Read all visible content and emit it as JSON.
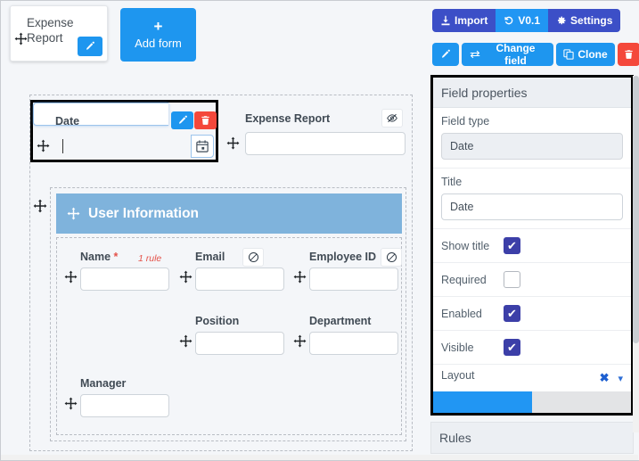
{
  "form_tabs": [
    {
      "label": "Expense Report",
      "edit_icon": "pencil-icon",
      "move_icon": "move-cross-icon"
    }
  ],
  "add_form_button": {
    "label": "Add form",
    "plus": "+",
    "icon": "plus-icon"
  },
  "toolbar_top": [
    {
      "label": "Import",
      "icon": "import-download-icon",
      "color": "#3c4fc7"
    },
    {
      "label": "V0.1",
      "icon": "history-undo-icon",
      "color": "#2196f3"
    },
    {
      "label": "Settings",
      "icon": "gear-icon",
      "color": "#3c4fc7"
    }
  ],
  "toolbar_second": [
    {
      "label": "",
      "icon": "pencil-icon",
      "color": "#1e96ef"
    },
    {
      "label": "Change field",
      "icon": "exchange-arrows-icon",
      "color": "#1e96ef"
    },
    {
      "label": "Clone",
      "icon": "copy-icon",
      "color": "#1e96ef"
    },
    {
      "label": "",
      "icon": "trash-icon",
      "color": "#f4483b"
    }
  ],
  "canvas": {
    "date_field": {
      "label": "Date",
      "value": "",
      "selected": true,
      "edit_icon": "pencil-icon",
      "delete_icon": "trash-icon",
      "calendar_icon": "calendar-icon",
      "move_icon": "move-cross-icon"
    },
    "expense_report_field": {
      "label": "Expense Report",
      "value": "",
      "state_icon": "eye-slash-icon",
      "move_icon": "move-cross-icon"
    },
    "section": {
      "title": "User Information",
      "move_icon": "move-cross-icon",
      "fields": [
        {
          "label": "Name",
          "required": true,
          "required_marker": "*",
          "rule_tag": "1 rule",
          "value": "",
          "state_icon": null,
          "move_icon": "move-cross-icon"
        },
        {
          "label": "Email",
          "required": false,
          "required_marker": "",
          "rule_tag": "",
          "value": "",
          "state_icon": "ban-icon",
          "move_icon": "move-cross-icon"
        },
        {
          "label": "Employee ID",
          "required": false,
          "required_marker": "",
          "rule_tag": "",
          "value": "",
          "state_icon": "ban-icon",
          "move_icon": "move-cross-icon"
        },
        {
          "label": "Position",
          "required": false,
          "required_marker": "",
          "rule_tag": "",
          "value": "",
          "state_icon": null,
          "move_icon": "move-cross-icon"
        },
        {
          "label": "Department",
          "required": false,
          "required_marker": "",
          "rule_tag": "",
          "value": "",
          "state_icon": null,
          "move_icon": "move-cross-icon"
        },
        {
          "label": "Manager",
          "required": false,
          "required_marker": "",
          "rule_tag": "",
          "value": "",
          "state_icon": null,
          "move_icon": "move-cross-icon"
        }
      ]
    }
  },
  "properties": {
    "header": "Field properties",
    "field_type": {
      "label": "Field type",
      "value": "Date"
    },
    "title": {
      "label": "Title",
      "value": "Date"
    },
    "show_title": {
      "label": "Show title",
      "checked": true,
      "check_glyph": "✔"
    },
    "required": {
      "label": "Required",
      "checked": false,
      "check_glyph": ""
    },
    "enabled": {
      "label": "Enabled",
      "checked": true,
      "check_glyph": "✔"
    },
    "visible": {
      "label": "Visible",
      "checked": true,
      "check_glyph": "✔"
    },
    "layout": {
      "label": "Layout",
      "clear_icon": "close-x-icon",
      "expand_icon": "chevron-down-icon",
      "fill_percent": 50
    }
  },
  "rules_panel": {
    "header": "Rules"
  },
  "colors": {
    "accent_blue": "#1e96ef",
    "indigo": "#3c4fc7",
    "danger_red": "#f4483b",
    "section_header_blue": "#7fb3dc",
    "checkbox_on": "#3c3fa8",
    "page_bg": "#f4f6f9"
  }
}
